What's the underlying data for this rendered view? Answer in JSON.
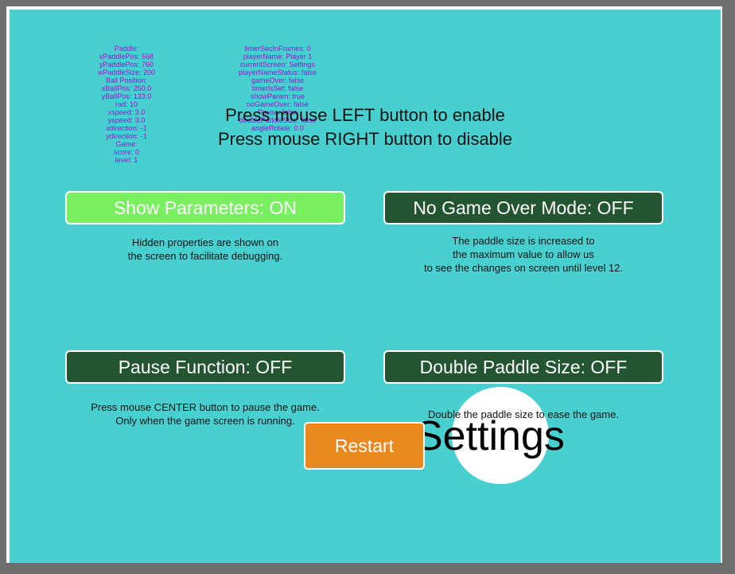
{
  "debug_left": [
    "Paddle:",
    "xPaddlePos: 568",
    "yPaddlePos: 760",
    "wPaddleSize: 200",
    "Ball Position:",
    "xBallPos: 250.0",
    "yBallPos: 133.0",
    "rad: 10",
    "xspeed: 3.0",
    "yspeed: 3.0",
    "xdirection: -1",
    "ydirection: -1",
    "Game:",
    "score: 0",
    "level: 1"
  ],
  "debug_right": [
    "timerSecInFrames: 0",
    "playerName: Player 1",
    "currentScreen: Settings",
    "playerNameStatus: false",
    "gameOver: false",
    "timerIsSet: false",
    "showParam: true",
    "noGameOver: false",
    "Pause: false",
    "doublePaddleSize: false",
    "angleRotate: 0.0"
  ],
  "instructions": {
    "line1": "Press mouse LEFT button to enable",
    "line2": "Press mouse RIGHT button to disable"
  },
  "options": {
    "show_parameters": {
      "label": "Show Parameters: ON",
      "state": "ON",
      "color": "#78f060",
      "desc": [
        "Hidden properties are shown on",
        "the screen to facilitate debugging."
      ]
    },
    "no_game_over": {
      "label": "No Game Over Mode: OFF",
      "state": "OFF",
      "color": "#225530",
      "desc": [
        "The paddle size is increased to",
        "the maximum value to allow us",
        "to see the changes on screen until level 12."
      ]
    },
    "pause_function": {
      "label": "Pause Function: OFF",
      "state": "OFF",
      "color": "#225530",
      "desc": [
        "Press mouse CENTER button to pause the game.",
        "Only when the game screen is running."
      ]
    },
    "double_paddle": {
      "label": "Double Paddle Size: OFF",
      "state": "OFF",
      "color": "#225530",
      "desc": [
        "Double the paddle size to ease the game."
      ]
    }
  },
  "screen_title": "Settings",
  "restart_label": "Restart",
  "colors": {
    "background": "#48d0d0",
    "debug_text": "#c000d0",
    "restart": "#ea8820"
  }
}
